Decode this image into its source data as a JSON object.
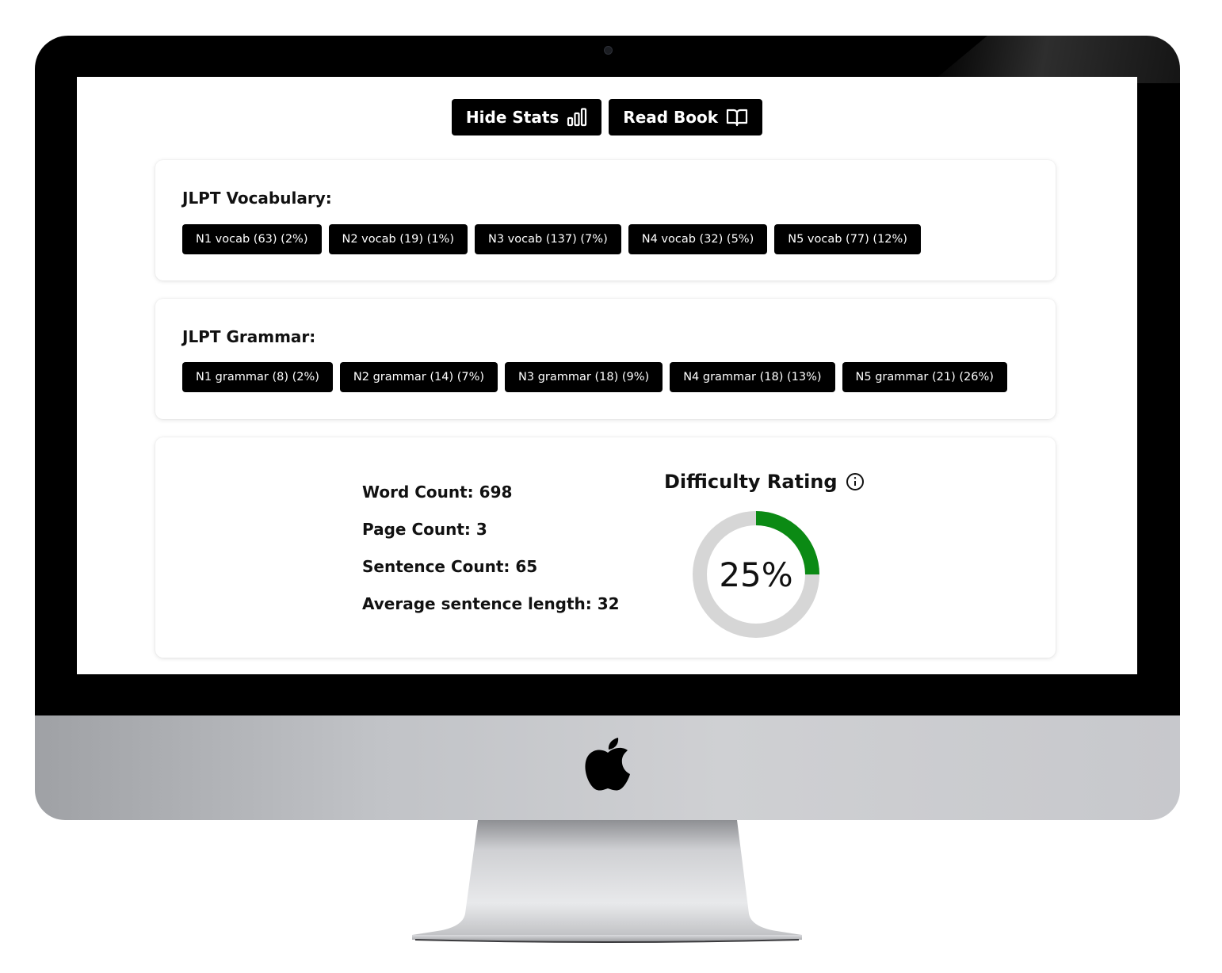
{
  "toolbar": {
    "hide_stats_label": "Hide Stats",
    "read_book_label": "Read Book"
  },
  "vocabulary": {
    "title": "JLPT Vocabulary:",
    "tags": [
      "N1 vocab (63) (2%)",
      "N2 vocab (19) (1%)",
      "N3 vocab (137) (7%)",
      "N4 vocab (32) (5%)",
      "N5 vocab (77) (12%)"
    ]
  },
  "grammar": {
    "title": "JLPT Grammar:",
    "tags": [
      "N1 grammar (8) (2%)",
      "N2 grammar (14) (7%)",
      "N3 grammar (18) (9%)",
      "N4 grammar (18) (13%)",
      "N5 grammar (21) (26%)"
    ]
  },
  "stats": {
    "word_count": "Word Count: 698",
    "page_count": "Page Count: 3",
    "sentence_count": "Sentence Count: 65",
    "avg_sentence_length": "Average sentence length: 32"
  },
  "difficulty": {
    "title": "Difficulty Rating",
    "value_label": "25%",
    "fraction": 0.25,
    "fill_color": "#0b8a14",
    "track_color": "#d6d6d6"
  },
  "icons": {
    "hide_stats": "bar-chart-icon",
    "read_book": "book-open-icon",
    "difficulty_info": "info-icon",
    "chin_logo": "apple-logo"
  }
}
